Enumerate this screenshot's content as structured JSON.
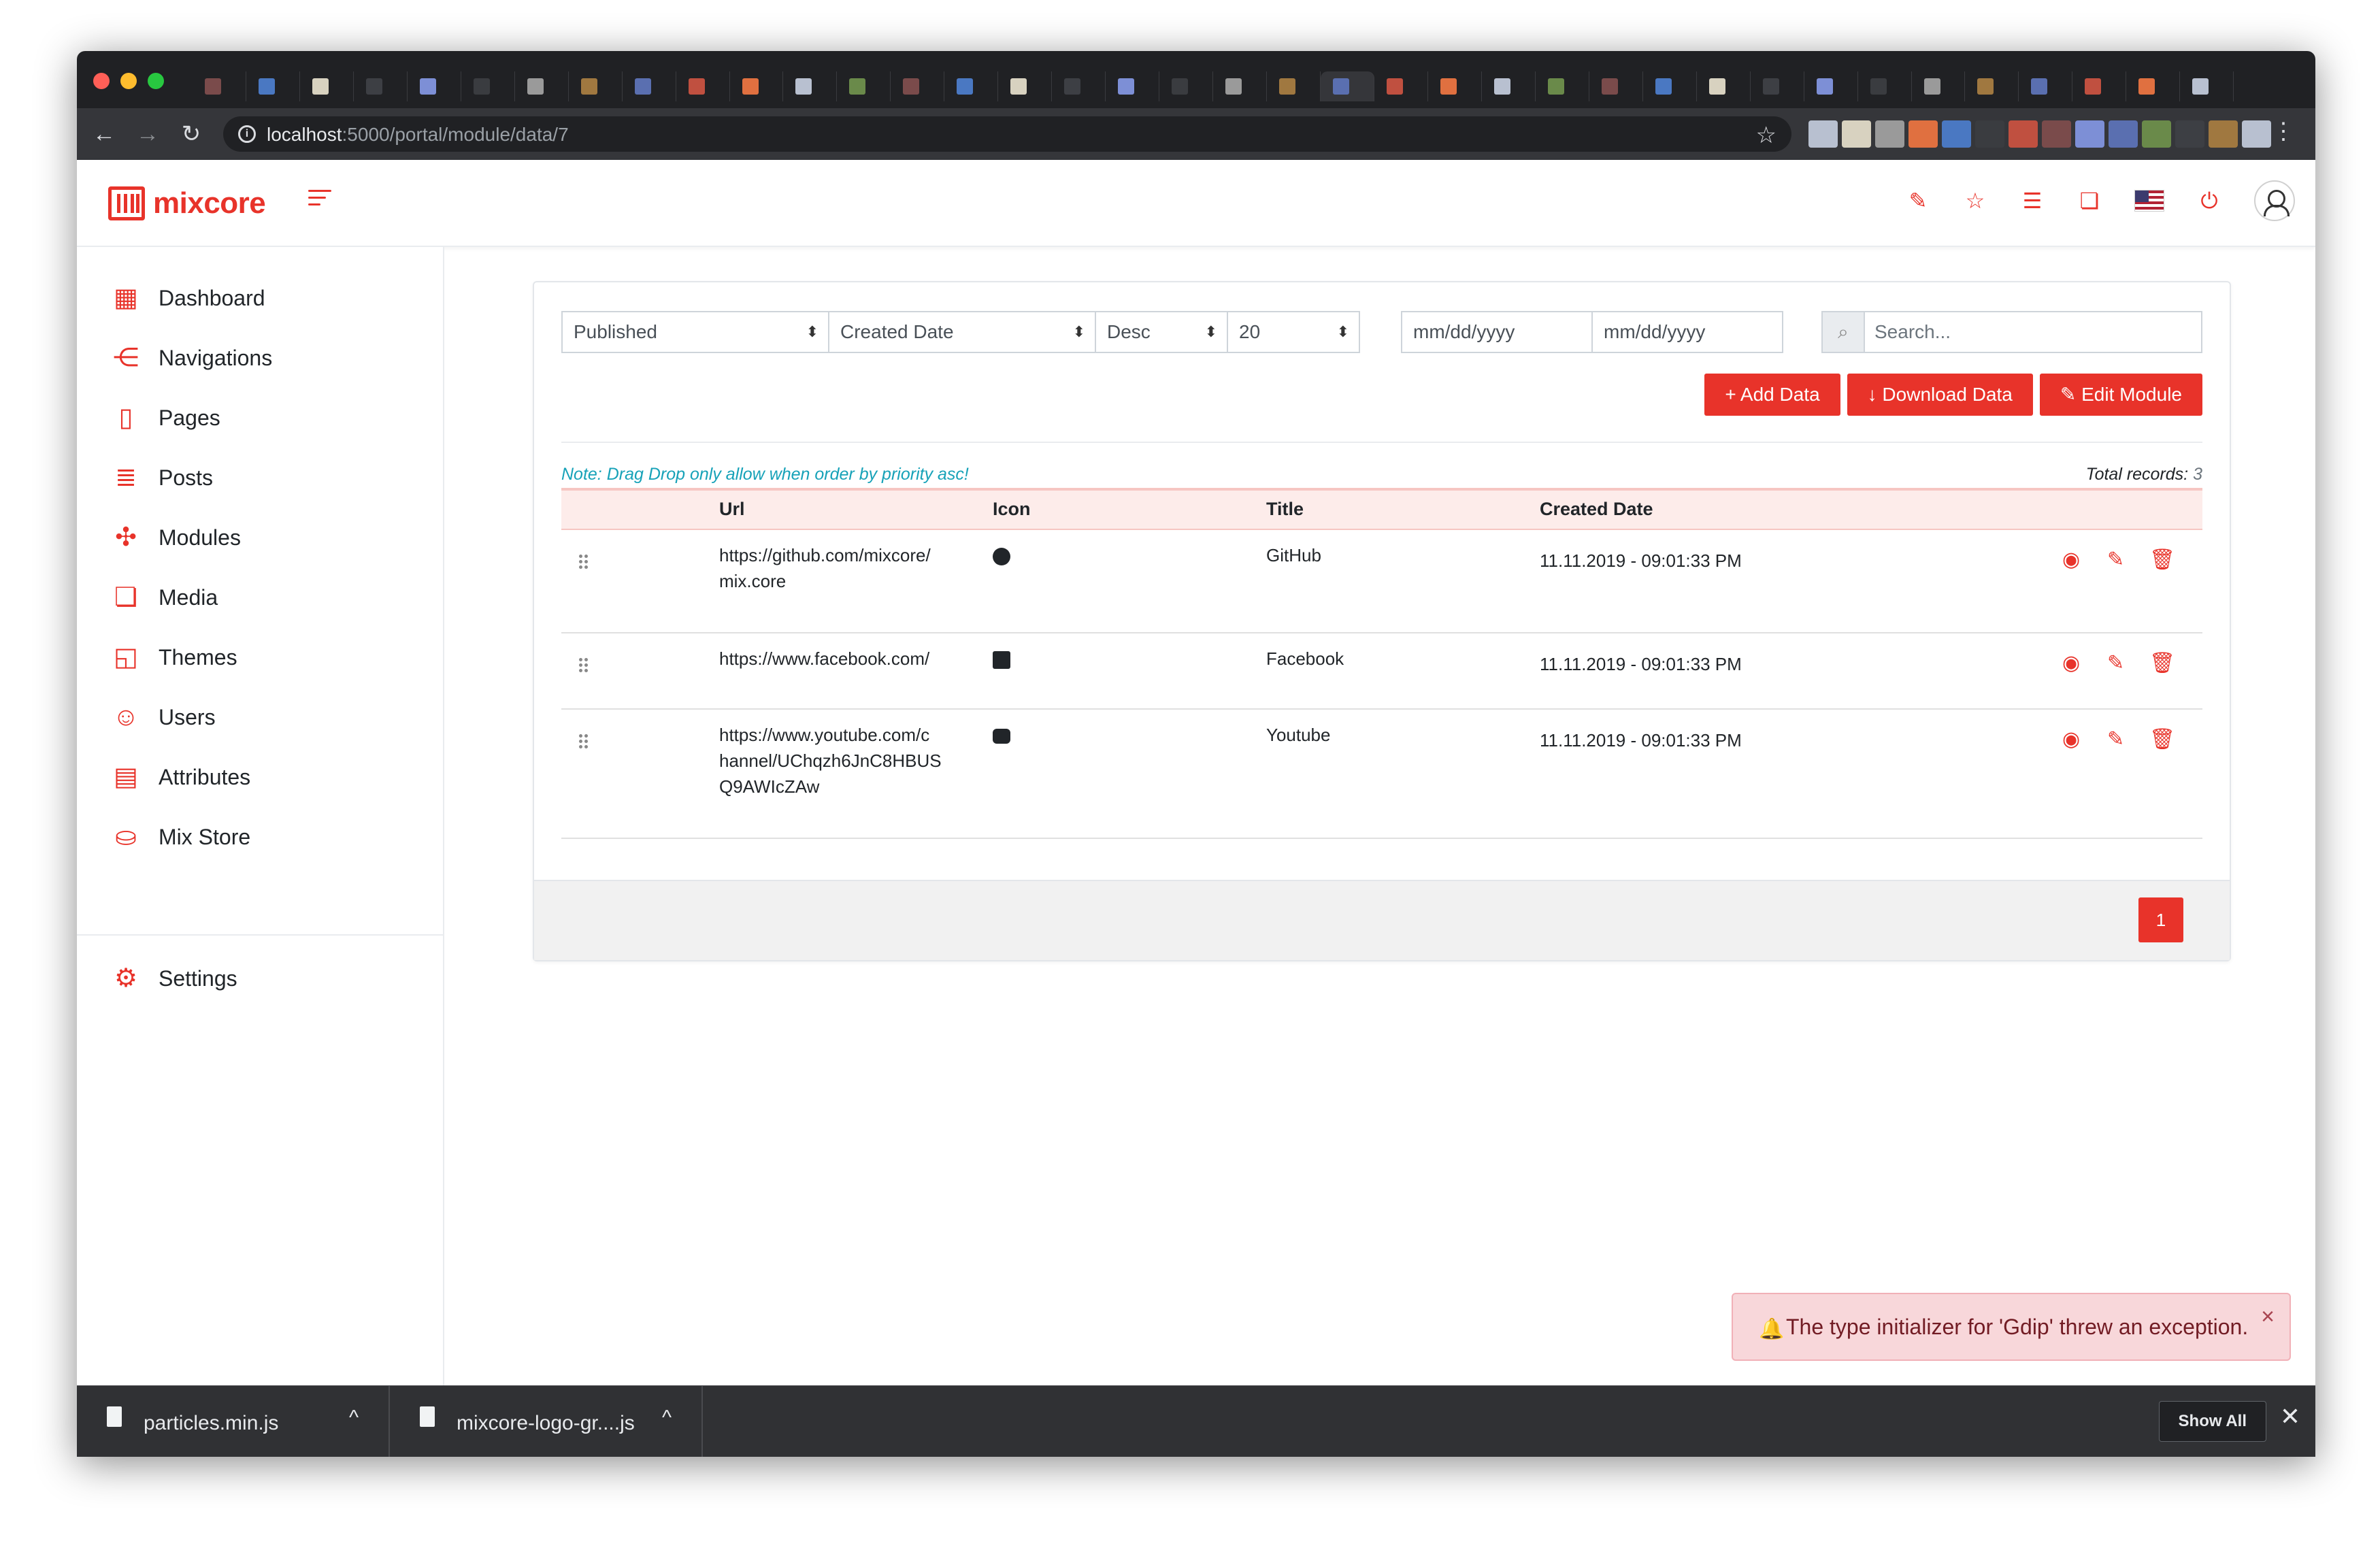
{
  "browser": {
    "url_host": "localhost",
    "url_rest": ":5000/portal/module/data/7",
    "icons": [
      "back-arrow-icon",
      "forward-arrow-icon",
      "reload-icon",
      "info-icon",
      "star-icon",
      "menu-dots-icon"
    ]
  },
  "app": {
    "logo_text": "mixcore",
    "brand_color": "#e8332a",
    "header_icons": [
      "edit-icon",
      "star-list-icon",
      "list-icon",
      "media-icon",
      "us-flag-icon",
      "power-icon",
      "user-avatar-icon"
    ]
  },
  "sidebar": {
    "items": [
      {
        "label": "Dashboard",
        "icon": "dashboard-icon"
      },
      {
        "label": "Navigations",
        "icon": "share-icon"
      },
      {
        "label": "Pages",
        "icon": "page-icon"
      },
      {
        "label": "Posts",
        "icon": "posts-icon"
      },
      {
        "label": "Modules",
        "icon": "puzzle-icon"
      },
      {
        "label": "Media",
        "icon": "media-icon"
      },
      {
        "label": "Themes",
        "icon": "themes-icon"
      },
      {
        "label": "Users",
        "icon": "smile-icon"
      },
      {
        "label": "Attributes",
        "icon": "attributes-icon"
      },
      {
        "label": "Mix Store",
        "icon": "shopping-bag-icon"
      }
    ],
    "settings": {
      "label": "Settings",
      "icon": "gear-icon"
    }
  },
  "filters": {
    "status": "Published",
    "order_by": "Created Date",
    "direction": "Desc",
    "page_size": "20",
    "date_from_placeholder": "mm/dd/yyyy",
    "date_to_placeholder": "mm/dd/yyyy",
    "search_placeholder": "Search..."
  },
  "actions": {
    "add": "+ Add Data",
    "download": "↓ Download Data",
    "edit": "✎ Edit Module"
  },
  "list": {
    "note": "Note: Drag Drop only allow when order by priority asc!",
    "total_label": "Total records:",
    "total_value": "3",
    "columns": [
      "Url",
      "Icon",
      "Title",
      "Created Date"
    ],
    "rows": [
      {
        "url_lines": [
          "https://github.com/mixcore/",
          "mix.core"
        ],
        "icon": "github-icon",
        "title": "GitHub",
        "created": "11.11.2019 - 09:01:33 PM"
      },
      {
        "url_lines": [
          "https://www.facebook.com/"
        ],
        "icon": "facebook-icon",
        "title": "Facebook",
        "created": "11.11.2019 - 09:01:33 PM"
      },
      {
        "url_lines": [
          "https://www.youtube.com/c",
          "hannel/UChqzh6JnC8HBUS",
          "Q9AWIcZAw"
        ],
        "icon": "youtube-icon",
        "title": "Youtube",
        "created": "11.11.2019 - 09:01:33 PM"
      }
    ],
    "page": "1"
  },
  "toast": {
    "message": "The type initializer for 'Gdip' threw an exception.",
    "close": "×"
  },
  "downloads": {
    "items": [
      "particles.min.js",
      "mixcore-logo-gr....js"
    ],
    "show_all": "Show All",
    "close": "✕"
  }
}
